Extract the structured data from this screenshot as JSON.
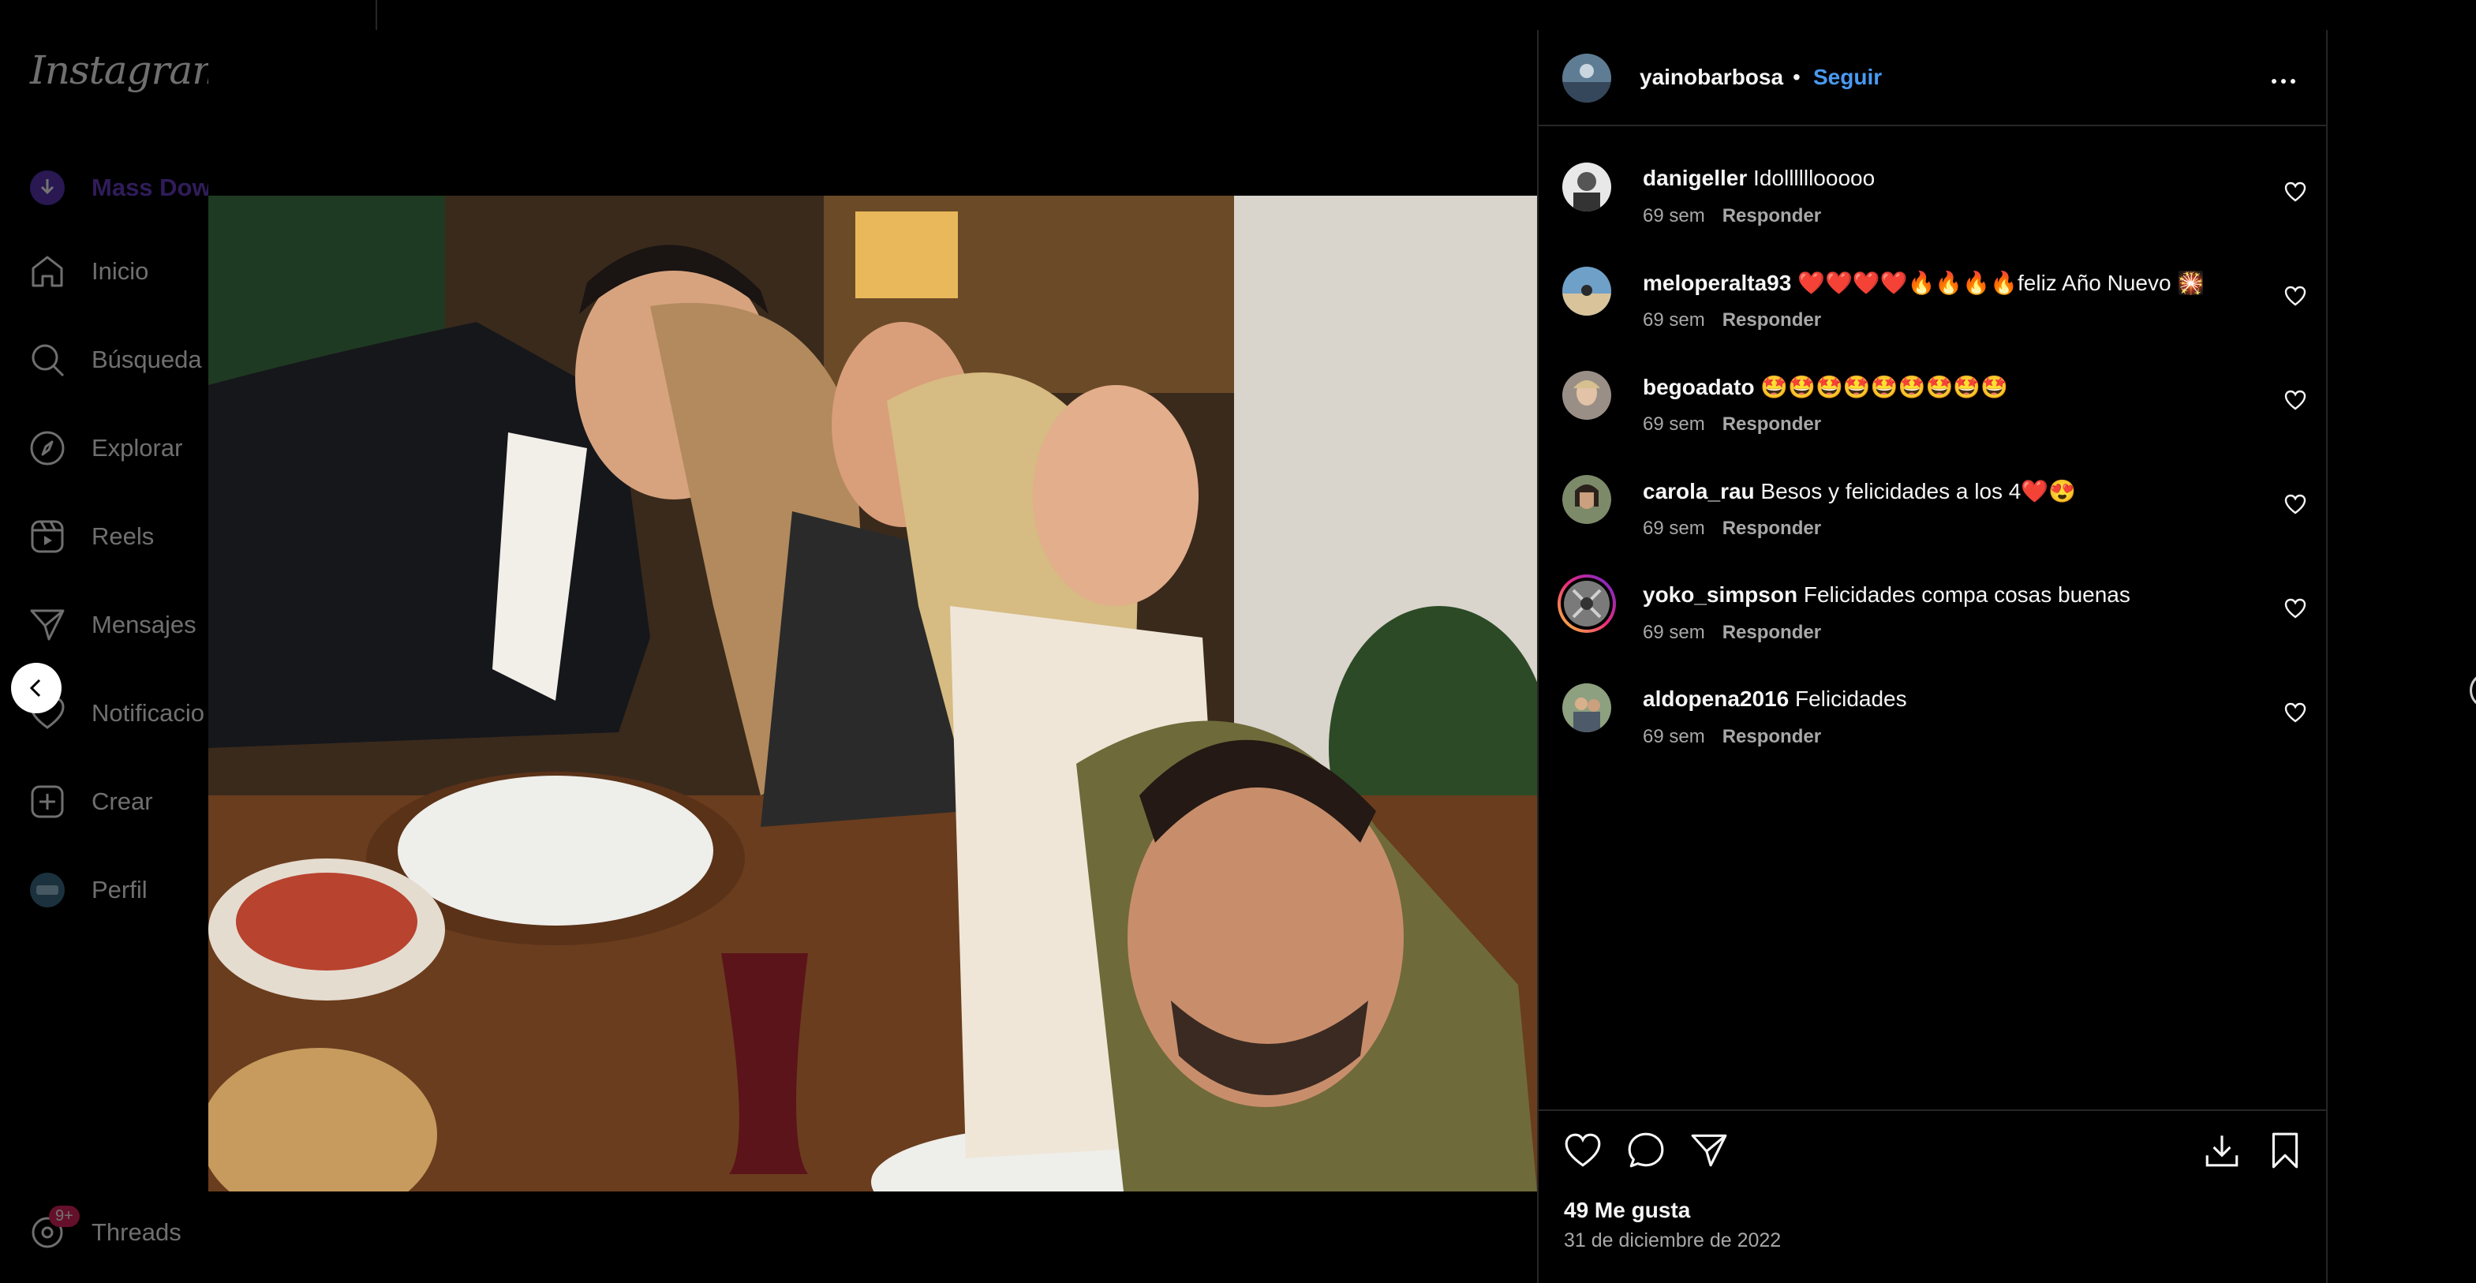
{
  "app": {
    "logo": "Instagram"
  },
  "sidebar": {
    "items": [
      {
        "label": "Mass Dow",
        "icon": "mass-download-icon"
      },
      {
        "label": "Inicio",
        "icon": "home-icon"
      },
      {
        "label": "Búsqueda",
        "icon": "search-icon"
      },
      {
        "label": "Explorar",
        "icon": "compass-icon"
      },
      {
        "label": "Reels",
        "icon": "reels-icon"
      },
      {
        "label": "Mensajes",
        "icon": "messages-icon"
      },
      {
        "label": "Notificacio",
        "icon": "heart-icon"
      },
      {
        "label": "Crear",
        "icon": "create-icon"
      },
      {
        "label": "Perfil",
        "icon": "profile-avatar-icon"
      },
      {
        "label": "Threads",
        "icon": "threads-icon"
      }
    ],
    "threads_badge": "9+"
  },
  "post": {
    "author": "yainobarbosa",
    "separator": "•",
    "follow_label": "Seguir",
    "likes": "49 Me gusta",
    "date": "31 de diciembre de 2022"
  },
  "comments": [
    {
      "user": "danigeller",
      "text": "Idollllllooooo",
      "time": "69 sem",
      "reply": "Responder"
    },
    {
      "user": "meloperalta93",
      "text": "❤️❤️❤️❤️🔥🔥🔥🔥feliz Año Nuevo 🎇",
      "time": "69 sem",
      "reply": "Responder"
    },
    {
      "user": "begoadato",
      "text": "🤩🤩🤩🤩🤩🤩🤩🤩🤩",
      "time": "69 sem",
      "reply": "Responder"
    },
    {
      "user": "carola_rau",
      "text": "Besos y felicidades a los 4❤️😍",
      "time": "69 sem",
      "reply": "Responder"
    },
    {
      "user": "yoko_simpson",
      "text": "Felicidades compa cosas buenas",
      "time": "69 sem",
      "reply": "Responder"
    },
    {
      "user": "aldopena2016",
      "text": "Felicidades",
      "time": "69 sem",
      "reply": "Responder"
    }
  ],
  "colors": {
    "accent": "#4a9af2",
    "background": "#000000",
    "border": "#262626",
    "muted": "#a8a8a8"
  }
}
